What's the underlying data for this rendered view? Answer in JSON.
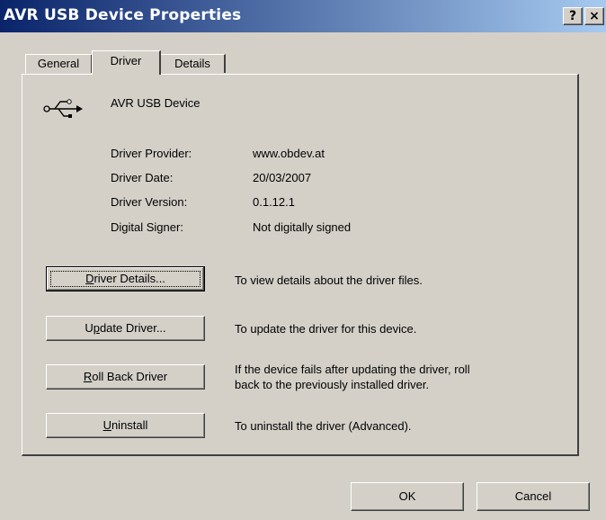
{
  "window": {
    "title": "AVR USB Device Properties",
    "help_label": "?",
    "close_label": "×"
  },
  "tabs": [
    {
      "label": "General",
      "active": false
    },
    {
      "label": "Driver",
      "active": true
    },
    {
      "label": "Details",
      "active": false
    }
  ],
  "device": {
    "icon": "usb-icon",
    "name": "AVR USB Device"
  },
  "info": [
    {
      "label": "Driver Provider:",
      "value": "www.obdev.at"
    },
    {
      "label": "Driver Date:",
      "value": "20/03/2007"
    },
    {
      "label": "Driver Version:",
      "value": "0.1.12.1"
    },
    {
      "label": "Digital Signer:",
      "value": "Not digitally signed"
    }
  ],
  "actions": [
    {
      "label": "Driver Details...",
      "accel_pre": "",
      "accel_key": "D",
      "accel_post": "river Details...",
      "desc_1": "To view details about the driver files.",
      "desc_2": ""
    },
    {
      "label": "Update Driver...",
      "accel_pre": "U",
      "accel_key": "p",
      "accel_post": "date Driver...",
      "desc_1": "To update the driver for this device.",
      "desc_2": ""
    },
    {
      "label": "Roll Back Driver",
      "accel_pre": "",
      "accel_key": "R",
      "accel_post": "oll Back Driver",
      "desc_1": "If the device fails after updating the driver, roll",
      "desc_2": "back to the previously installed driver."
    },
    {
      "label": "Uninstall",
      "accel_pre": "",
      "accel_key": "U",
      "accel_post": "ninstall",
      "desc_1": "To uninstall the driver (Advanced).",
      "desc_2": ""
    }
  ],
  "footer": {
    "ok_label": "OK",
    "cancel_label": "Cancel"
  },
  "colors": {
    "titlebar_start": "#0a246a",
    "titlebar_end": "#a6caf0",
    "face": "#d4d0c8"
  }
}
